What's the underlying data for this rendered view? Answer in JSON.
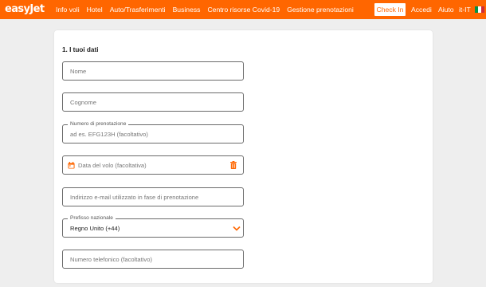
{
  "header": {
    "logo": "easyJet",
    "nav": [
      "Info voli",
      "Hotel",
      "Auto/Trasferimenti",
      "Business",
      "Centro risorse Covid-19",
      "Gestione prenotazioni"
    ],
    "check_in": "Check In",
    "login": "Accedi",
    "help": "Aiuto",
    "language": "it-IT",
    "flag_colors": [
      "#009246",
      "#ffffff",
      "#ce2b37"
    ]
  },
  "form": {
    "section_title": "1. I tuoi dati",
    "first_name_placeholder": "Nome",
    "last_name_placeholder": "Cognome",
    "booking_label": "Numero di prenotazione",
    "booking_placeholder": "ad es. EFG123H (facoltativo)",
    "flight_date_placeholder": "Data del volo (facoltativa)",
    "email_placeholder": "Indirizzo e-mail utilizzato in fase di prenotazione",
    "country_code_label": "Prefisso nazionale",
    "country_code_value": "Regno Unito (+44)",
    "phone_placeholder": "Numero telefonico (facoltativo)"
  },
  "colors": {
    "brand": "#ff6600"
  }
}
